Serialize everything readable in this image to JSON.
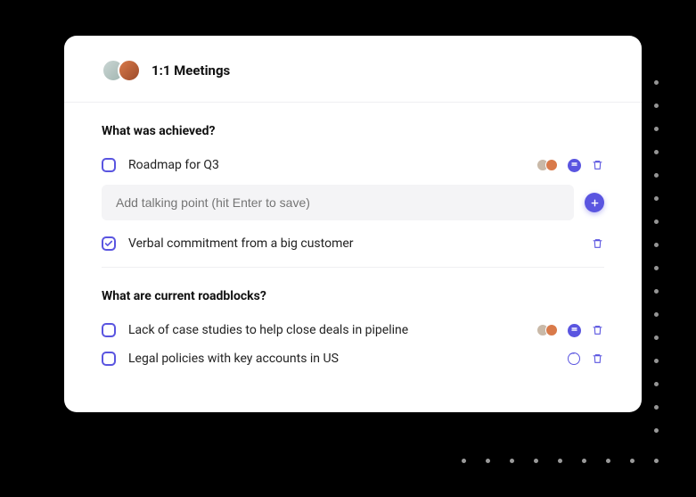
{
  "colors": {
    "accent": "#5a55e0",
    "avatar1": "#cbd6d4",
    "avatar2": "#d97a4a"
  },
  "header": {
    "title": "1:1 Meetings"
  },
  "input": {
    "placeholder": "Add talking point (hit Enter to save)"
  },
  "sections": [
    {
      "title": "What was achieved?",
      "items": [
        {
          "text": "Roadmap for Q3",
          "checked": false,
          "has_avatars": true,
          "has_comment_filled": true,
          "has_trash": true
        },
        {
          "text": "Verbal commitment from a big customer",
          "checked": true,
          "has_avatars": false,
          "has_comment_filled": false,
          "has_trash": true
        }
      ]
    },
    {
      "title": "What are current roadblocks?",
      "items": [
        {
          "text": "Lack of case studies to help close deals in pipeline",
          "checked": false,
          "has_avatars": true,
          "has_comment_filled": true,
          "has_trash": true
        },
        {
          "text": "Legal policies with key accounts in US",
          "checked": false,
          "has_avatars": false,
          "has_comment_outline": true,
          "has_trash": true
        }
      ]
    }
  ]
}
